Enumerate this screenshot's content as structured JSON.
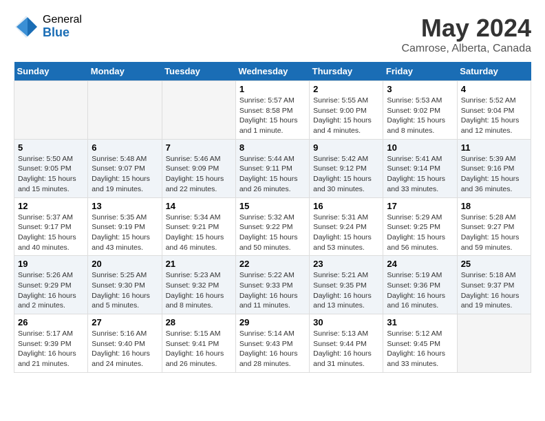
{
  "logo": {
    "general": "General",
    "blue": "Blue"
  },
  "title": "May 2024",
  "subtitle": "Camrose, Alberta, Canada",
  "days_of_week": [
    "Sunday",
    "Monday",
    "Tuesday",
    "Wednesday",
    "Thursday",
    "Friday",
    "Saturday"
  ],
  "weeks": [
    [
      {
        "day": "",
        "info": ""
      },
      {
        "day": "",
        "info": ""
      },
      {
        "day": "",
        "info": ""
      },
      {
        "day": "1",
        "info": "Sunrise: 5:57 AM\nSunset: 8:58 PM\nDaylight: 15 hours\nand 1 minute."
      },
      {
        "day": "2",
        "info": "Sunrise: 5:55 AM\nSunset: 9:00 PM\nDaylight: 15 hours\nand 4 minutes."
      },
      {
        "day": "3",
        "info": "Sunrise: 5:53 AM\nSunset: 9:02 PM\nDaylight: 15 hours\nand 8 minutes."
      },
      {
        "day": "4",
        "info": "Sunrise: 5:52 AM\nSunset: 9:04 PM\nDaylight: 15 hours\nand 12 minutes."
      }
    ],
    [
      {
        "day": "5",
        "info": "Sunrise: 5:50 AM\nSunset: 9:05 PM\nDaylight: 15 hours\nand 15 minutes."
      },
      {
        "day": "6",
        "info": "Sunrise: 5:48 AM\nSunset: 9:07 PM\nDaylight: 15 hours\nand 19 minutes."
      },
      {
        "day": "7",
        "info": "Sunrise: 5:46 AM\nSunset: 9:09 PM\nDaylight: 15 hours\nand 22 minutes."
      },
      {
        "day": "8",
        "info": "Sunrise: 5:44 AM\nSunset: 9:11 PM\nDaylight: 15 hours\nand 26 minutes."
      },
      {
        "day": "9",
        "info": "Sunrise: 5:42 AM\nSunset: 9:12 PM\nDaylight: 15 hours\nand 30 minutes."
      },
      {
        "day": "10",
        "info": "Sunrise: 5:41 AM\nSunset: 9:14 PM\nDaylight: 15 hours\nand 33 minutes."
      },
      {
        "day": "11",
        "info": "Sunrise: 5:39 AM\nSunset: 9:16 PM\nDaylight: 15 hours\nand 36 minutes."
      }
    ],
    [
      {
        "day": "12",
        "info": "Sunrise: 5:37 AM\nSunset: 9:17 PM\nDaylight: 15 hours\nand 40 minutes."
      },
      {
        "day": "13",
        "info": "Sunrise: 5:35 AM\nSunset: 9:19 PM\nDaylight: 15 hours\nand 43 minutes."
      },
      {
        "day": "14",
        "info": "Sunrise: 5:34 AM\nSunset: 9:21 PM\nDaylight: 15 hours\nand 46 minutes."
      },
      {
        "day": "15",
        "info": "Sunrise: 5:32 AM\nSunset: 9:22 PM\nDaylight: 15 hours\nand 50 minutes."
      },
      {
        "day": "16",
        "info": "Sunrise: 5:31 AM\nSunset: 9:24 PM\nDaylight: 15 hours\nand 53 minutes."
      },
      {
        "day": "17",
        "info": "Sunrise: 5:29 AM\nSunset: 9:25 PM\nDaylight: 15 hours\nand 56 minutes."
      },
      {
        "day": "18",
        "info": "Sunrise: 5:28 AM\nSunset: 9:27 PM\nDaylight: 15 hours\nand 59 minutes."
      }
    ],
    [
      {
        "day": "19",
        "info": "Sunrise: 5:26 AM\nSunset: 9:29 PM\nDaylight: 16 hours\nand 2 minutes."
      },
      {
        "day": "20",
        "info": "Sunrise: 5:25 AM\nSunset: 9:30 PM\nDaylight: 16 hours\nand 5 minutes."
      },
      {
        "day": "21",
        "info": "Sunrise: 5:23 AM\nSunset: 9:32 PM\nDaylight: 16 hours\nand 8 minutes."
      },
      {
        "day": "22",
        "info": "Sunrise: 5:22 AM\nSunset: 9:33 PM\nDaylight: 16 hours\nand 11 minutes."
      },
      {
        "day": "23",
        "info": "Sunrise: 5:21 AM\nSunset: 9:35 PM\nDaylight: 16 hours\nand 13 minutes."
      },
      {
        "day": "24",
        "info": "Sunrise: 5:19 AM\nSunset: 9:36 PM\nDaylight: 16 hours\nand 16 minutes."
      },
      {
        "day": "25",
        "info": "Sunrise: 5:18 AM\nSunset: 9:37 PM\nDaylight: 16 hours\nand 19 minutes."
      }
    ],
    [
      {
        "day": "26",
        "info": "Sunrise: 5:17 AM\nSunset: 9:39 PM\nDaylight: 16 hours\nand 21 minutes."
      },
      {
        "day": "27",
        "info": "Sunrise: 5:16 AM\nSunset: 9:40 PM\nDaylight: 16 hours\nand 24 minutes."
      },
      {
        "day": "28",
        "info": "Sunrise: 5:15 AM\nSunset: 9:41 PM\nDaylight: 16 hours\nand 26 minutes."
      },
      {
        "day": "29",
        "info": "Sunrise: 5:14 AM\nSunset: 9:43 PM\nDaylight: 16 hours\nand 28 minutes."
      },
      {
        "day": "30",
        "info": "Sunrise: 5:13 AM\nSunset: 9:44 PM\nDaylight: 16 hours\nand 31 minutes."
      },
      {
        "day": "31",
        "info": "Sunrise: 5:12 AM\nSunset: 9:45 PM\nDaylight: 16 hours\nand 33 minutes."
      },
      {
        "day": "",
        "info": ""
      }
    ]
  ]
}
